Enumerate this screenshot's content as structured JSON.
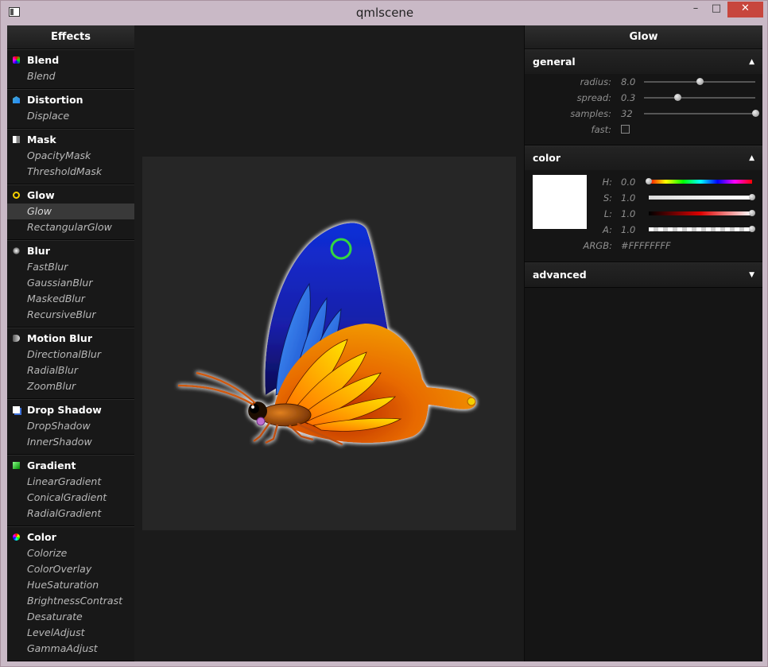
{
  "window": {
    "title": "qmlscene",
    "minimize": "–",
    "maximize": "□",
    "close": "✕"
  },
  "left_panel": {
    "header": "Effects",
    "groups": [
      {
        "label": "Blend",
        "icon": "blend-icon",
        "items": [
          "Blend"
        ]
      },
      {
        "label": "Distortion",
        "icon": "distortion-icon",
        "items": [
          "Displace"
        ]
      },
      {
        "label": "Mask",
        "icon": "mask-icon",
        "items": [
          "OpacityMask",
          "ThresholdMask"
        ]
      },
      {
        "label": "Glow",
        "icon": "glow-icon",
        "items": [
          "Glow",
          "RectangularGlow"
        ]
      },
      {
        "label": "Blur",
        "icon": "blur-icon",
        "items": [
          "FastBlur",
          "GaussianBlur",
          "MaskedBlur",
          "RecursiveBlur"
        ]
      },
      {
        "label": "Motion Blur",
        "icon": "motion-blur-icon",
        "items": [
          "DirectionalBlur",
          "RadialBlur",
          "ZoomBlur"
        ]
      },
      {
        "label": "Drop Shadow",
        "icon": "drop-shadow-icon",
        "items": [
          "DropShadow",
          "InnerShadow"
        ]
      },
      {
        "label": "Gradient",
        "icon": "gradient-icon",
        "items": [
          "LinearGradient",
          "ConicalGradient",
          "RadialGradient"
        ]
      },
      {
        "label": "Color",
        "icon": "color-icon",
        "items": [
          "Colorize",
          "ColorOverlay",
          "HueSaturation",
          "BrightnessContrast",
          "Desaturate",
          "LevelAdjust",
          "GammaAdjust"
        ]
      }
    ],
    "selected_item": "Glow"
  },
  "right_panel": {
    "header": "Glow",
    "general": {
      "title": "general",
      "arrow": "▲",
      "params": [
        {
          "label": "radius:",
          "value": "8.0",
          "level": 0.5
        },
        {
          "label": "spread:",
          "value": "0.3",
          "level": 0.3
        },
        {
          "label": "samples:",
          "value": "32",
          "level": 1.0
        }
      ],
      "fast_label": "fast:",
      "fast_checked": false
    },
    "color": {
      "title": "color",
      "arrow": "▲",
      "swatch": "#FFFFFF",
      "channels": [
        {
          "label": "H:",
          "value": "0.0",
          "level": 0.0
        },
        {
          "label": "S:",
          "value": "1.0",
          "level": 1.0
        },
        {
          "label": "L:",
          "value": "1.0",
          "level": 1.0
        },
        {
          "label": "A:",
          "value": "1.0",
          "level": 1.0
        }
      ],
      "argb_label": "ARGB:",
      "argb_value": "#FFFFFFFF"
    },
    "advanced": {
      "title": "advanced",
      "arrow": "▼"
    }
  },
  "colors": {
    "glow_ring": "#34d640",
    "wing_blue": "#1a1fb8",
    "wing_orange": "#f07a00",
    "close_button": "#c7463d"
  }
}
